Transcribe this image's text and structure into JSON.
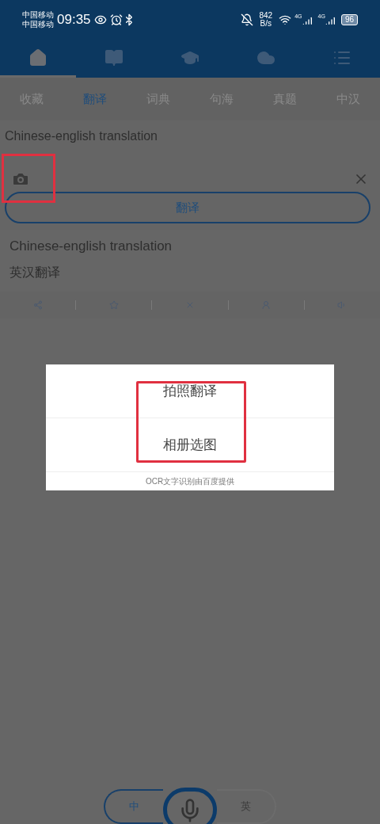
{
  "status_bar": {
    "carriers": [
      "中国移动",
      "中国移动"
    ],
    "time": "09:35",
    "speed_value": "842",
    "speed_unit": "B/s",
    "networks": [
      "4G",
      "4G"
    ],
    "battery": "96"
  },
  "nav_tabs": [
    {
      "kind": "home",
      "selected": true
    },
    {
      "kind": "book",
      "selected": false
    },
    {
      "kind": "school",
      "selected": false
    },
    {
      "kind": "cloud",
      "selected": false
    },
    {
      "kind": "list",
      "selected": false
    }
  ],
  "sub_tabs": [
    {
      "label": "收藏",
      "selected": false
    },
    {
      "label": "翻译",
      "selected": true
    },
    {
      "label": "词典",
      "selected": false
    },
    {
      "label": "句海",
      "selected": false
    },
    {
      "label": "真题",
      "selected": false
    },
    {
      "label": "中汉",
      "selected": false
    }
  ],
  "input": {
    "value": "Chinese-english translation",
    "camera_highlighted": true
  },
  "translate_button": "翻译",
  "result": {
    "source": "Chinese-english translation",
    "translation": "英汉翻译"
  },
  "actions": [
    {
      "kind": "share"
    },
    {
      "kind": "star"
    },
    {
      "kind": "close"
    },
    {
      "kind": "speak"
    },
    {
      "kind": "volume"
    }
  ],
  "dialog": {
    "options": [
      "拍照翻译",
      "相册选图"
    ],
    "highlighted": true,
    "footer": "OCR文字识别由百度提供"
  },
  "language_switch": [
    {
      "label": "中",
      "selected": true
    },
    {
      "label": "英",
      "selected": false
    }
  ]
}
